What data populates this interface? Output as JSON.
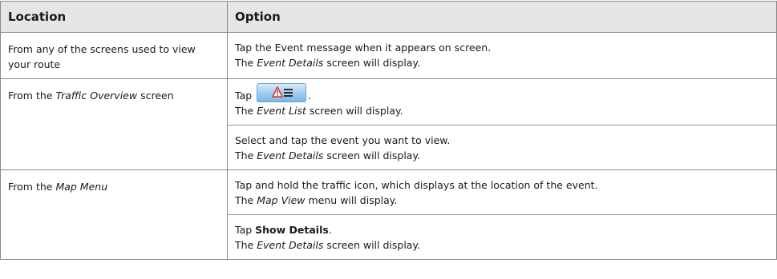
{
  "table": {
    "headers": [
      "Location",
      "Option"
    ],
    "rows": [
      {
        "location": {
          "prefix": "From any of the screens used to view your route",
          "em": "",
          "suffix": ""
        },
        "options": [
          {
            "l1_pre": "Tap the Event message when it appears on screen.",
            "l1_bold": "",
            "l1_post": "",
            "l2_pre": "The ",
            "l2_em": "Event Details",
            "l2_post": " screen will display."
          }
        ]
      },
      {
        "location": {
          "prefix": "From the ",
          "em": "Traffic Overview",
          "suffix": " screen"
        },
        "options": [
          {
            "l1_pre": "Tap",
            "l1_post": ".",
            "has_button": true,
            "l2_pre": "The ",
            "l2_em": "Event List",
            "l2_post": " screen will display."
          },
          {
            "l1_pre": "Select and tap the event you want to view.",
            "l1_bold": "",
            "l1_post": "",
            "l2_pre": "The ",
            "l2_em": "Event Details",
            "l2_post": " screen will display."
          }
        ]
      },
      {
        "location": {
          "prefix": "From the ",
          "em": "Map Menu",
          "suffix": ""
        },
        "options": [
          {
            "l1_pre": "Tap and hold the traffic icon, which displays at the location of the event.",
            "l1_bold": "",
            "l1_post": "",
            "l2_pre": "The ",
            "l2_em": "Map View",
            "l2_post": " menu will display."
          },
          {
            "l1_pre": "Tap ",
            "l1_bold": "Show Details",
            "l1_post": ".",
            "l2_pre": "The ",
            "l2_em": "Event Details",
            "l2_post": " screen will display."
          }
        ]
      }
    ]
  },
  "icons": {
    "event_list_button": "traffic-event-list-icon"
  },
  "colors": {
    "header_bg": "#e6e6e6",
    "border": "#8a8a8a",
    "button_blue": "#9fcbec",
    "warning_red": "#d9302c"
  }
}
